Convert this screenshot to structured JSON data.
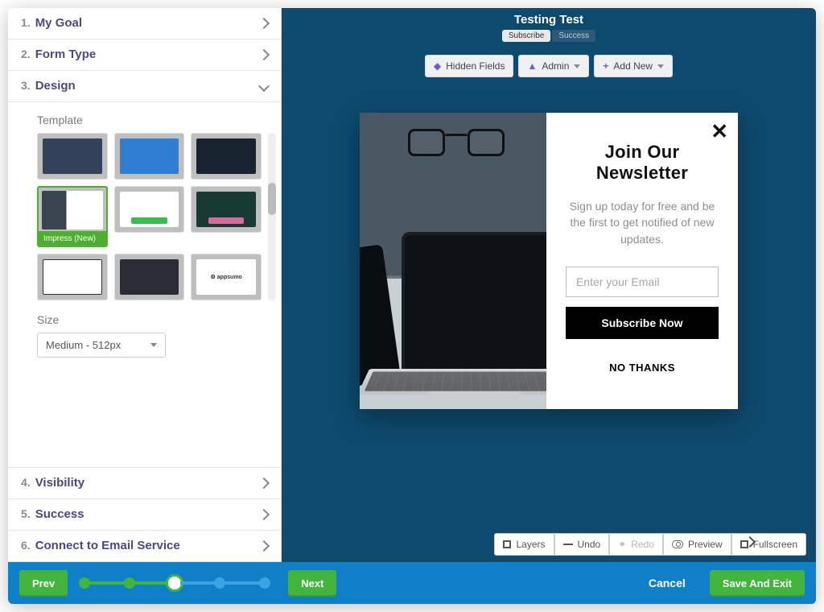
{
  "sidebar": {
    "items": [
      {
        "num": "1.",
        "label": "My Goal"
      },
      {
        "num": "2.",
        "label": "Form Type"
      },
      {
        "num": "3.",
        "label": "Design"
      },
      {
        "num": "4.",
        "label": "Visibility"
      },
      {
        "num": "5.",
        "label": "Success"
      },
      {
        "num": "6.",
        "label": "Connect to Email Service"
      }
    ],
    "template_label": "Template",
    "selected_template_badge": "Impress (New)",
    "size_label": "Size",
    "size_value": "Medium - 512px"
  },
  "canvas": {
    "title": "Testing Test",
    "tab_subscribe": "Subscribe",
    "tab_success": "Success",
    "toolbar": {
      "hidden_fields": "Hidden Fields",
      "admin": "Admin",
      "add_new": "Add New"
    },
    "popup": {
      "title": "Join Our Newsletter",
      "subtitle": "Sign up today for free and be the first to get notified of new updates.",
      "email_placeholder": "Enter your Email",
      "subscribe_btn": "Subscribe Now",
      "no_thanks": "NO THANKS"
    },
    "bottom": {
      "layers": "Layers",
      "undo": "Undo",
      "redo": "Redo",
      "preview": "Preview",
      "fullscreen": "Fullscreen"
    }
  },
  "footer": {
    "prev": "Prev",
    "next": "Next",
    "cancel": "Cancel",
    "save": "Save And Exit"
  }
}
